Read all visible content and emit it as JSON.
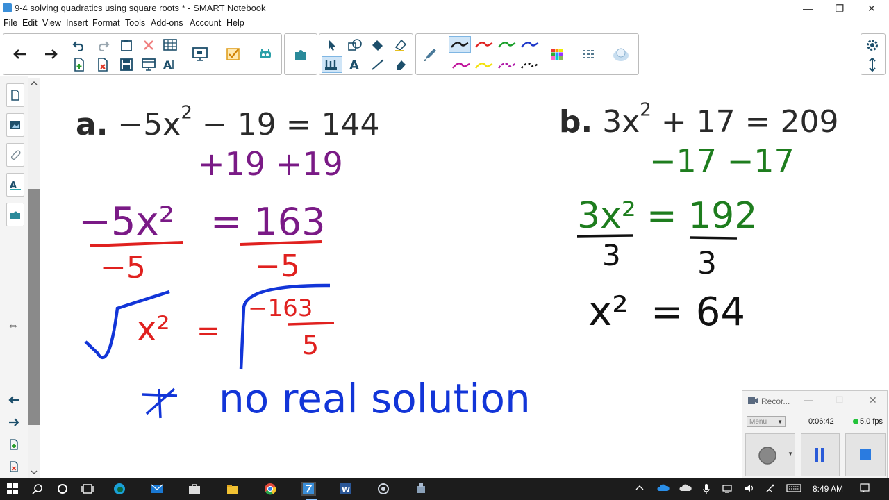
{
  "window": {
    "title": "9-4 solving quadratics using square roots * - SMART Notebook",
    "minimize": "—",
    "restore": "❐",
    "close": "✕"
  },
  "menu": [
    "File",
    "Edit",
    "View",
    "Insert",
    "Format",
    "Tools",
    "Add-ons",
    "Account",
    "Help"
  ],
  "toolbar": {
    "icons": [
      "back-arrow",
      "forward-arrow",
      "undo",
      "redo",
      "paste",
      "delete",
      "table",
      "add-page",
      "delete-page",
      "save",
      "screen-shade",
      "text-fonts",
      "display",
      "activity-check",
      "lesson-activity",
      "add-on",
      "select",
      "shapes",
      "fill",
      "erase-fill",
      "pen",
      "pen-types",
      "text",
      "line",
      "eraser",
      "colors",
      "properties",
      "magic-pen"
    ],
    "pen_colors": [
      "#1a1a1a",
      "#e0211f",
      "#1aa02a",
      "#1d37c9",
      "#c0139b",
      "#f3e10d",
      "#b01aa8",
      "#111111"
    ],
    "selected_pen_color": "#1a1a1a"
  },
  "sidebar": {
    "tabs": [
      "page-sorter",
      "gallery",
      "attachments",
      "properties",
      "add-ons"
    ],
    "bottom": [
      "previous-page",
      "next-page",
      "add-page",
      "delete-page"
    ],
    "move_handle": "⇔"
  },
  "canvas": {
    "problem_a": {
      "label": "a.",
      "expr_left": "−5x",
      "exp": "2",
      "expr_right": "− 19 = 144"
    },
    "problem_b": {
      "label": "b.",
      "expr_left": "3x",
      "exp": "2",
      "expr_right": "+ 17 = 209"
    },
    "ink": {
      "a_step1": "+19  +19",
      "a_step2_left": "−5x²",
      "a_step2_right": "= 163",
      "a_div_left": "−5",
      "a_div_right": "−5",
      "a_sqrt_left": "x²",
      "a_sqrt_eq": "=",
      "a_sqrt_num": "−163",
      "a_sqrt_den": "5",
      "a_conclusion": "no real solution",
      "b_step1": "−17   −17",
      "b_step2_left": "3x²",
      "b_step2_right": "= 192",
      "b_div_left": "3",
      "b_div_right": "3",
      "b_result_left": "x²",
      "b_result_right": "= 64"
    },
    "colors": {
      "purple": "#7a1a86",
      "red": "#e0211f",
      "blue": "#1235d8",
      "green": "#1e7d1e",
      "black": "#111111"
    }
  },
  "recorder": {
    "title": "Recor...",
    "menu_label": "Menu",
    "elapsed": "0:06:42",
    "fps": "5.0 fps",
    "fps_status_color": "#22c33a"
  },
  "taskbar": {
    "apps": [
      "start",
      "search",
      "cortana",
      "task-view",
      "edge",
      "mail",
      "store",
      "file-explorer",
      "chrome",
      "smart-notebook",
      "word",
      "screen-recorder",
      "smart-tools"
    ],
    "time": "8:49 AM"
  }
}
